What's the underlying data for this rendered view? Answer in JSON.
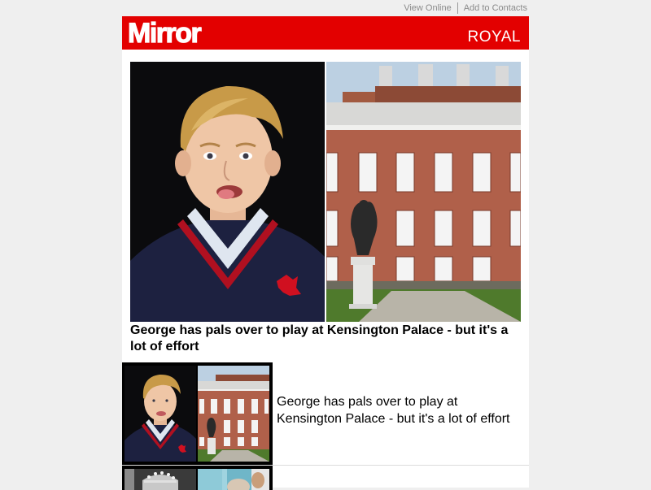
{
  "toplinks": {
    "view_online": "View Online",
    "add_contacts": "Add to Contacts"
  },
  "header": {
    "logo": "Mirror",
    "section": "ROYAL",
    "brand_color": "#e30000"
  },
  "hero": {
    "title": "George has pals over to play at Kensington Palace - but it's a lot of effort"
  },
  "stories": [
    {
      "text": "George has pals over to play at Kensington Palace - but it's a lot of effort"
    }
  ]
}
